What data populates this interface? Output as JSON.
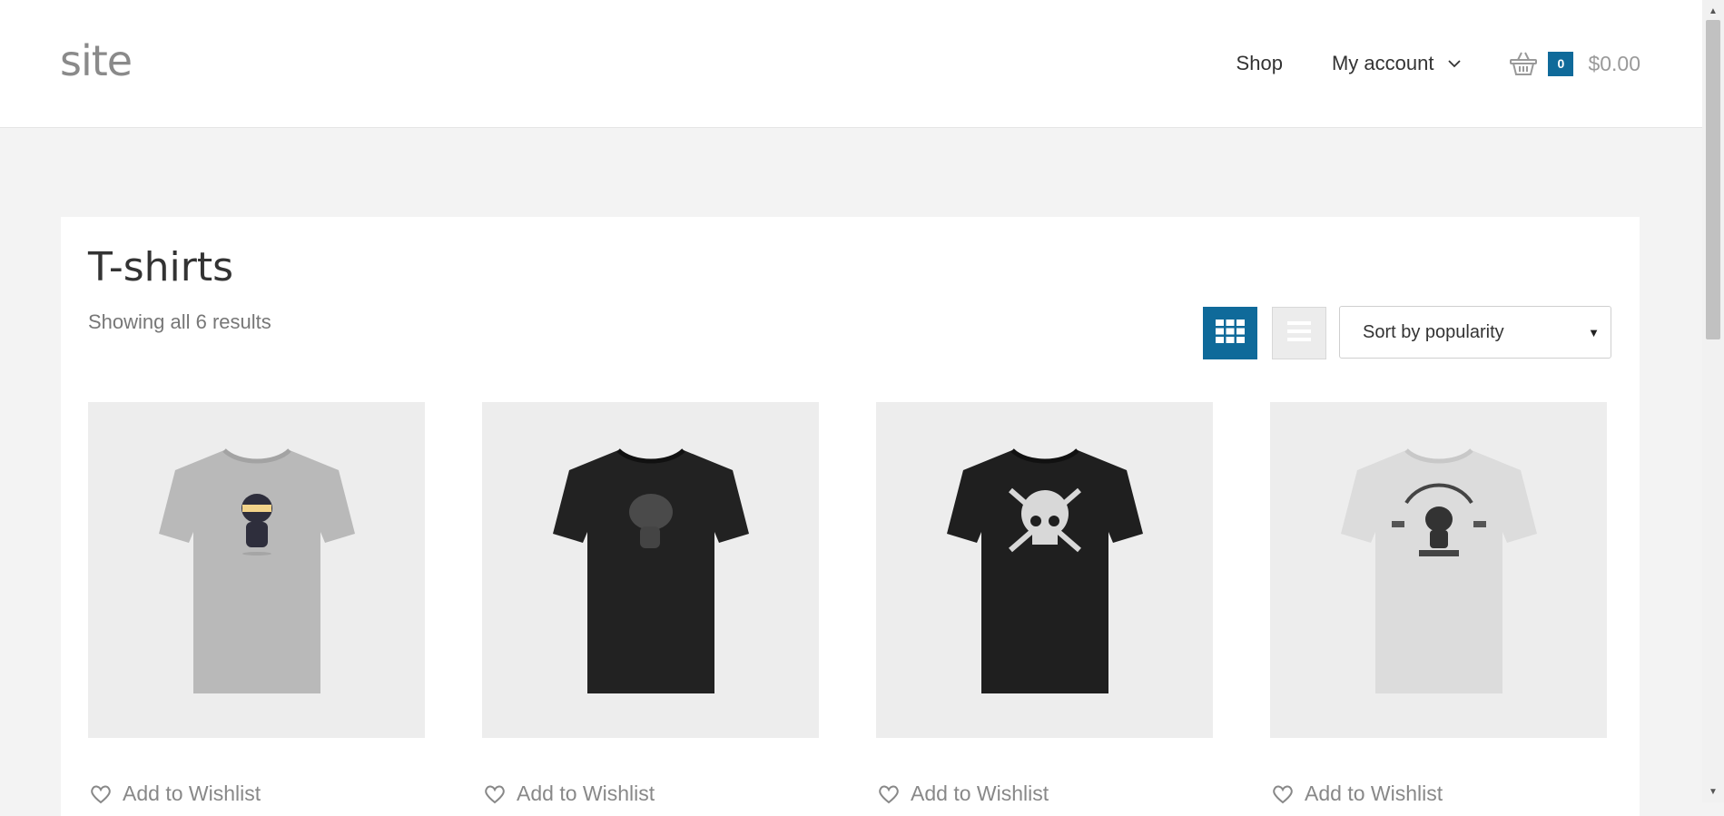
{
  "header": {
    "site_title": "site",
    "nav": {
      "shop": "Shop",
      "my_account": "My account"
    },
    "cart": {
      "count": "0",
      "total": "$0.00"
    }
  },
  "main": {
    "title": "T-shirts",
    "result_count": "Showing all 6 results",
    "sort": {
      "selected": "Sort by popularity"
    },
    "view_modes": [
      "grid-icon",
      "list-icon"
    ],
    "products": [
      {
        "shirt_color": "#b9b9b9",
        "graphic": "ninja",
        "wishlist_label": "Add to Wishlist"
      },
      {
        "shirt_color": "#222222",
        "graphic": "character",
        "wishlist_label": "Add to Wishlist"
      },
      {
        "shirt_color": "#1f1f1f",
        "graphic": "skull",
        "wishlist_label": "Add to Wishlist"
      },
      {
        "shirt_color": "#dcdcdc",
        "graphic": "woothemes",
        "wishlist_label": "Add to Wishlist"
      }
    ]
  },
  "colors": {
    "accent": "#0f6a9a",
    "background": "#f3f3f3",
    "panel": "#ffffff"
  }
}
